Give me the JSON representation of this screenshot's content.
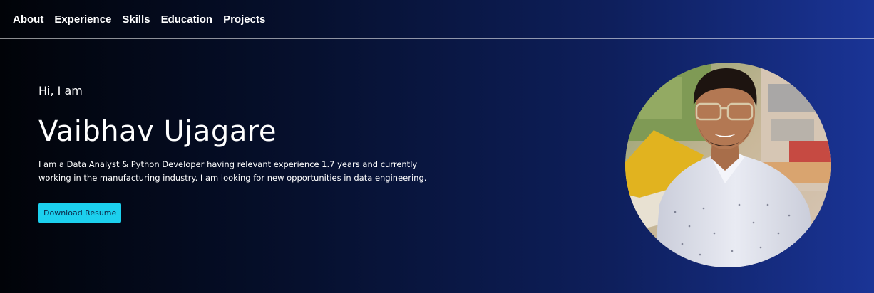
{
  "nav": {
    "items": [
      {
        "label": "About"
      },
      {
        "label": "Experience"
      },
      {
        "label": "Skills"
      },
      {
        "label": "Education"
      },
      {
        "label": "Projects"
      }
    ]
  },
  "hero": {
    "greeting": "Hi, I am",
    "name": "Vaibhav Ujagare",
    "bio": "I am a Data Analyst & Python Developer having relevant experience 1.7 years and currently working in the manufacturing industry. I am looking for new opportunities in data engineering.",
    "button_label": "Download Resume"
  },
  "colors": {
    "accent": "#1cd0ee",
    "background_start": "#010308",
    "background_end": "#1a3496"
  }
}
